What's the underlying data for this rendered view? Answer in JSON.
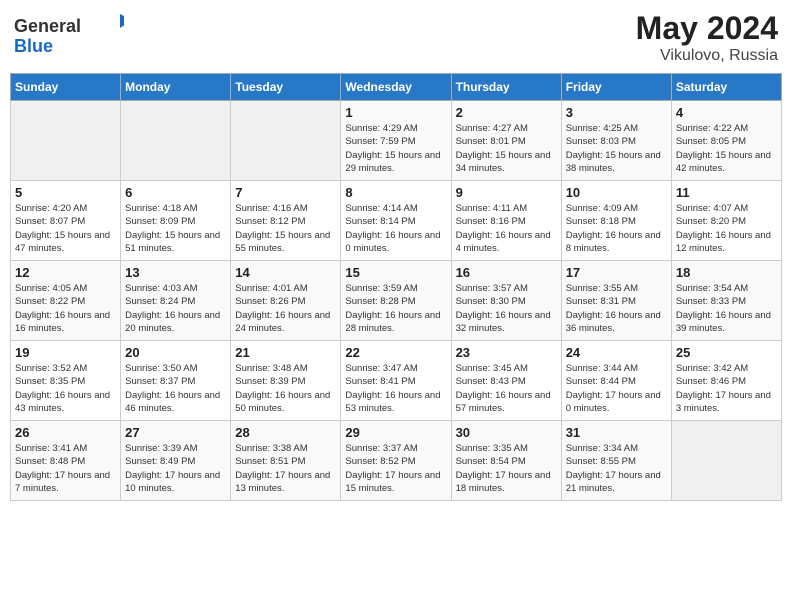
{
  "header": {
    "logo_general": "General",
    "logo_blue": "Blue",
    "month_year": "May 2024",
    "location": "Vikulovo, Russia"
  },
  "weekdays": [
    "Sunday",
    "Monday",
    "Tuesday",
    "Wednesday",
    "Thursday",
    "Friday",
    "Saturday"
  ],
  "weeks": [
    [
      {
        "day": "",
        "empty": true
      },
      {
        "day": "",
        "empty": true
      },
      {
        "day": "",
        "empty": true
      },
      {
        "day": "1",
        "sunrise": "4:29 AM",
        "sunset": "7:59 PM",
        "daylight": "15 hours and 29 minutes."
      },
      {
        "day": "2",
        "sunrise": "4:27 AM",
        "sunset": "8:01 PM",
        "daylight": "15 hours and 34 minutes."
      },
      {
        "day": "3",
        "sunrise": "4:25 AM",
        "sunset": "8:03 PM",
        "daylight": "15 hours and 38 minutes."
      },
      {
        "day": "4",
        "sunrise": "4:22 AM",
        "sunset": "8:05 PM",
        "daylight": "15 hours and 42 minutes."
      }
    ],
    [
      {
        "day": "5",
        "sunrise": "4:20 AM",
        "sunset": "8:07 PM",
        "daylight": "15 hours and 47 minutes."
      },
      {
        "day": "6",
        "sunrise": "4:18 AM",
        "sunset": "8:09 PM",
        "daylight": "15 hours and 51 minutes."
      },
      {
        "day": "7",
        "sunrise": "4:16 AM",
        "sunset": "8:12 PM",
        "daylight": "15 hours and 55 minutes."
      },
      {
        "day": "8",
        "sunrise": "4:14 AM",
        "sunset": "8:14 PM",
        "daylight": "16 hours and 0 minutes."
      },
      {
        "day": "9",
        "sunrise": "4:11 AM",
        "sunset": "8:16 PM",
        "daylight": "16 hours and 4 minutes."
      },
      {
        "day": "10",
        "sunrise": "4:09 AM",
        "sunset": "8:18 PM",
        "daylight": "16 hours and 8 minutes."
      },
      {
        "day": "11",
        "sunrise": "4:07 AM",
        "sunset": "8:20 PM",
        "daylight": "16 hours and 12 minutes."
      }
    ],
    [
      {
        "day": "12",
        "sunrise": "4:05 AM",
        "sunset": "8:22 PM",
        "daylight": "16 hours and 16 minutes."
      },
      {
        "day": "13",
        "sunrise": "4:03 AM",
        "sunset": "8:24 PM",
        "daylight": "16 hours and 20 minutes."
      },
      {
        "day": "14",
        "sunrise": "4:01 AM",
        "sunset": "8:26 PM",
        "daylight": "16 hours and 24 minutes."
      },
      {
        "day": "15",
        "sunrise": "3:59 AM",
        "sunset": "8:28 PM",
        "daylight": "16 hours and 28 minutes."
      },
      {
        "day": "16",
        "sunrise": "3:57 AM",
        "sunset": "8:30 PM",
        "daylight": "16 hours and 32 minutes."
      },
      {
        "day": "17",
        "sunrise": "3:55 AM",
        "sunset": "8:31 PM",
        "daylight": "16 hours and 36 minutes."
      },
      {
        "day": "18",
        "sunrise": "3:54 AM",
        "sunset": "8:33 PM",
        "daylight": "16 hours and 39 minutes."
      }
    ],
    [
      {
        "day": "19",
        "sunrise": "3:52 AM",
        "sunset": "8:35 PM",
        "daylight": "16 hours and 43 minutes."
      },
      {
        "day": "20",
        "sunrise": "3:50 AM",
        "sunset": "8:37 PM",
        "daylight": "16 hours and 46 minutes."
      },
      {
        "day": "21",
        "sunrise": "3:48 AM",
        "sunset": "8:39 PM",
        "daylight": "16 hours and 50 minutes."
      },
      {
        "day": "22",
        "sunrise": "3:47 AM",
        "sunset": "8:41 PM",
        "daylight": "16 hours and 53 minutes."
      },
      {
        "day": "23",
        "sunrise": "3:45 AM",
        "sunset": "8:43 PM",
        "daylight": "16 hours and 57 minutes."
      },
      {
        "day": "24",
        "sunrise": "3:44 AM",
        "sunset": "8:44 PM",
        "daylight": "17 hours and 0 minutes."
      },
      {
        "day": "25",
        "sunrise": "3:42 AM",
        "sunset": "8:46 PM",
        "daylight": "17 hours and 3 minutes."
      }
    ],
    [
      {
        "day": "26",
        "sunrise": "3:41 AM",
        "sunset": "8:48 PM",
        "daylight": "17 hours and 7 minutes."
      },
      {
        "day": "27",
        "sunrise": "3:39 AM",
        "sunset": "8:49 PM",
        "daylight": "17 hours and 10 minutes."
      },
      {
        "day": "28",
        "sunrise": "3:38 AM",
        "sunset": "8:51 PM",
        "daylight": "17 hours and 13 minutes."
      },
      {
        "day": "29",
        "sunrise": "3:37 AM",
        "sunset": "8:52 PM",
        "daylight": "17 hours and 15 minutes."
      },
      {
        "day": "30",
        "sunrise": "3:35 AM",
        "sunset": "8:54 PM",
        "daylight": "17 hours and 18 minutes."
      },
      {
        "day": "31",
        "sunrise": "3:34 AM",
        "sunset": "8:55 PM",
        "daylight": "17 hours and 21 minutes."
      },
      {
        "day": "",
        "empty": true
      }
    ]
  ],
  "labels": {
    "sunrise": "Sunrise:",
    "sunset": "Sunset:",
    "daylight": "Daylight:"
  }
}
